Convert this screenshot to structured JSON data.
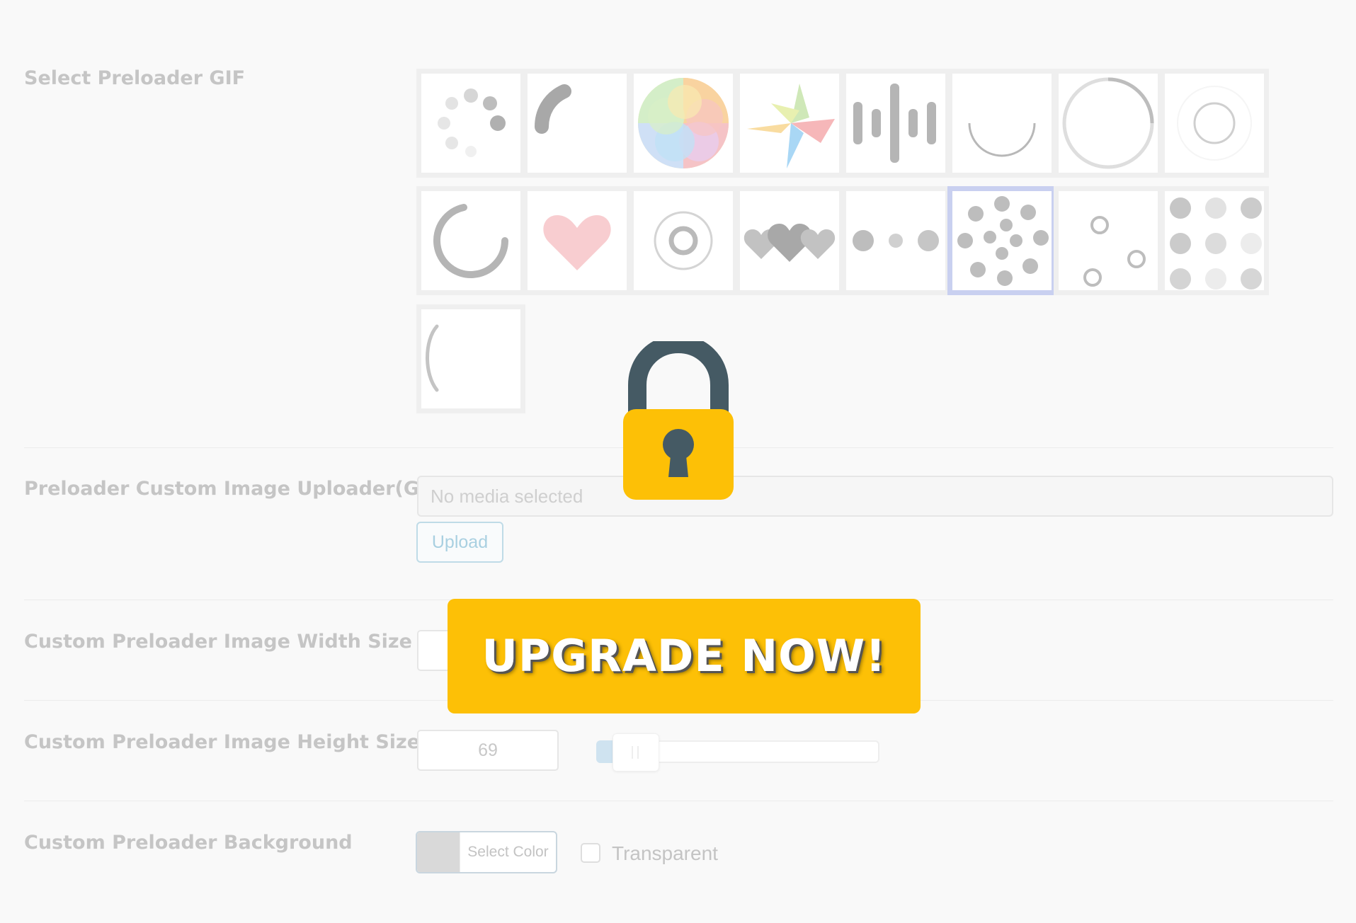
{
  "labels": {
    "select_gif": "Select Preloader GIF",
    "custom_uploader": "Preloader Custom Image Uploader(GIF)",
    "width_size": "Custom Preloader Image Width Size",
    "height_size": "Custom Preloader Image Height Size",
    "background": "Custom Preloader Background"
  },
  "gif_options": [
    {
      "icon": "dots-circle-spinner-icon",
      "selected": false
    },
    {
      "icon": "arc-spinner-icon",
      "selected": false
    },
    {
      "icon": "pastel-color-wheel-icon",
      "selected": false
    },
    {
      "icon": "pinwheel-icon",
      "selected": false
    },
    {
      "icon": "audio-bars-icon",
      "selected": false
    },
    {
      "icon": "thin-arc-spinner-icon",
      "selected": false
    },
    {
      "icon": "ring-spinner-icon",
      "selected": false
    },
    {
      "icon": "pulse-ring-icon",
      "selected": false
    },
    {
      "icon": "thick-arc-spinner-icon",
      "selected": false
    },
    {
      "icon": "heart-icon",
      "selected": false
    },
    {
      "icon": "concentric-rings-icon",
      "selected": false
    },
    {
      "icon": "three-hearts-icon",
      "selected": false
    },
    {
      "icon": "three-dots-icon",
      "selected": false
    },
    {
      "icon": "scattered-dots-icon",
      "selected": true
    },
    {
      "icon": "bouncing-rings-icon",
      "selected": false
    },
    {
      "icon": "dot-grid-icon",
      "selected": false
    },
    {
      "icon": "quarter-arc-icon",
      "selected": false
    }
  ],
  "uploader": {
    "placeholder": "No media selected",
    "upload_label": "Upload"
  },
  "height": {
    "value": "69",
    "slider_fraction": 0.07
  },
  "background": {
    "select_color_label": "Select Color",
    "transparent_label": "Transparent",
    "swatch_color": "#d9d9d9"
  },
  "overlay": {
    "upgrade_label": "UPGRADE NOW!",
    "lock_icon": "padlock-icon",
    "button_color": "#fdc006",
    "lock_body_color": "#fdc006",
    "lock_shackle_color": "#455a64"
  }
}
